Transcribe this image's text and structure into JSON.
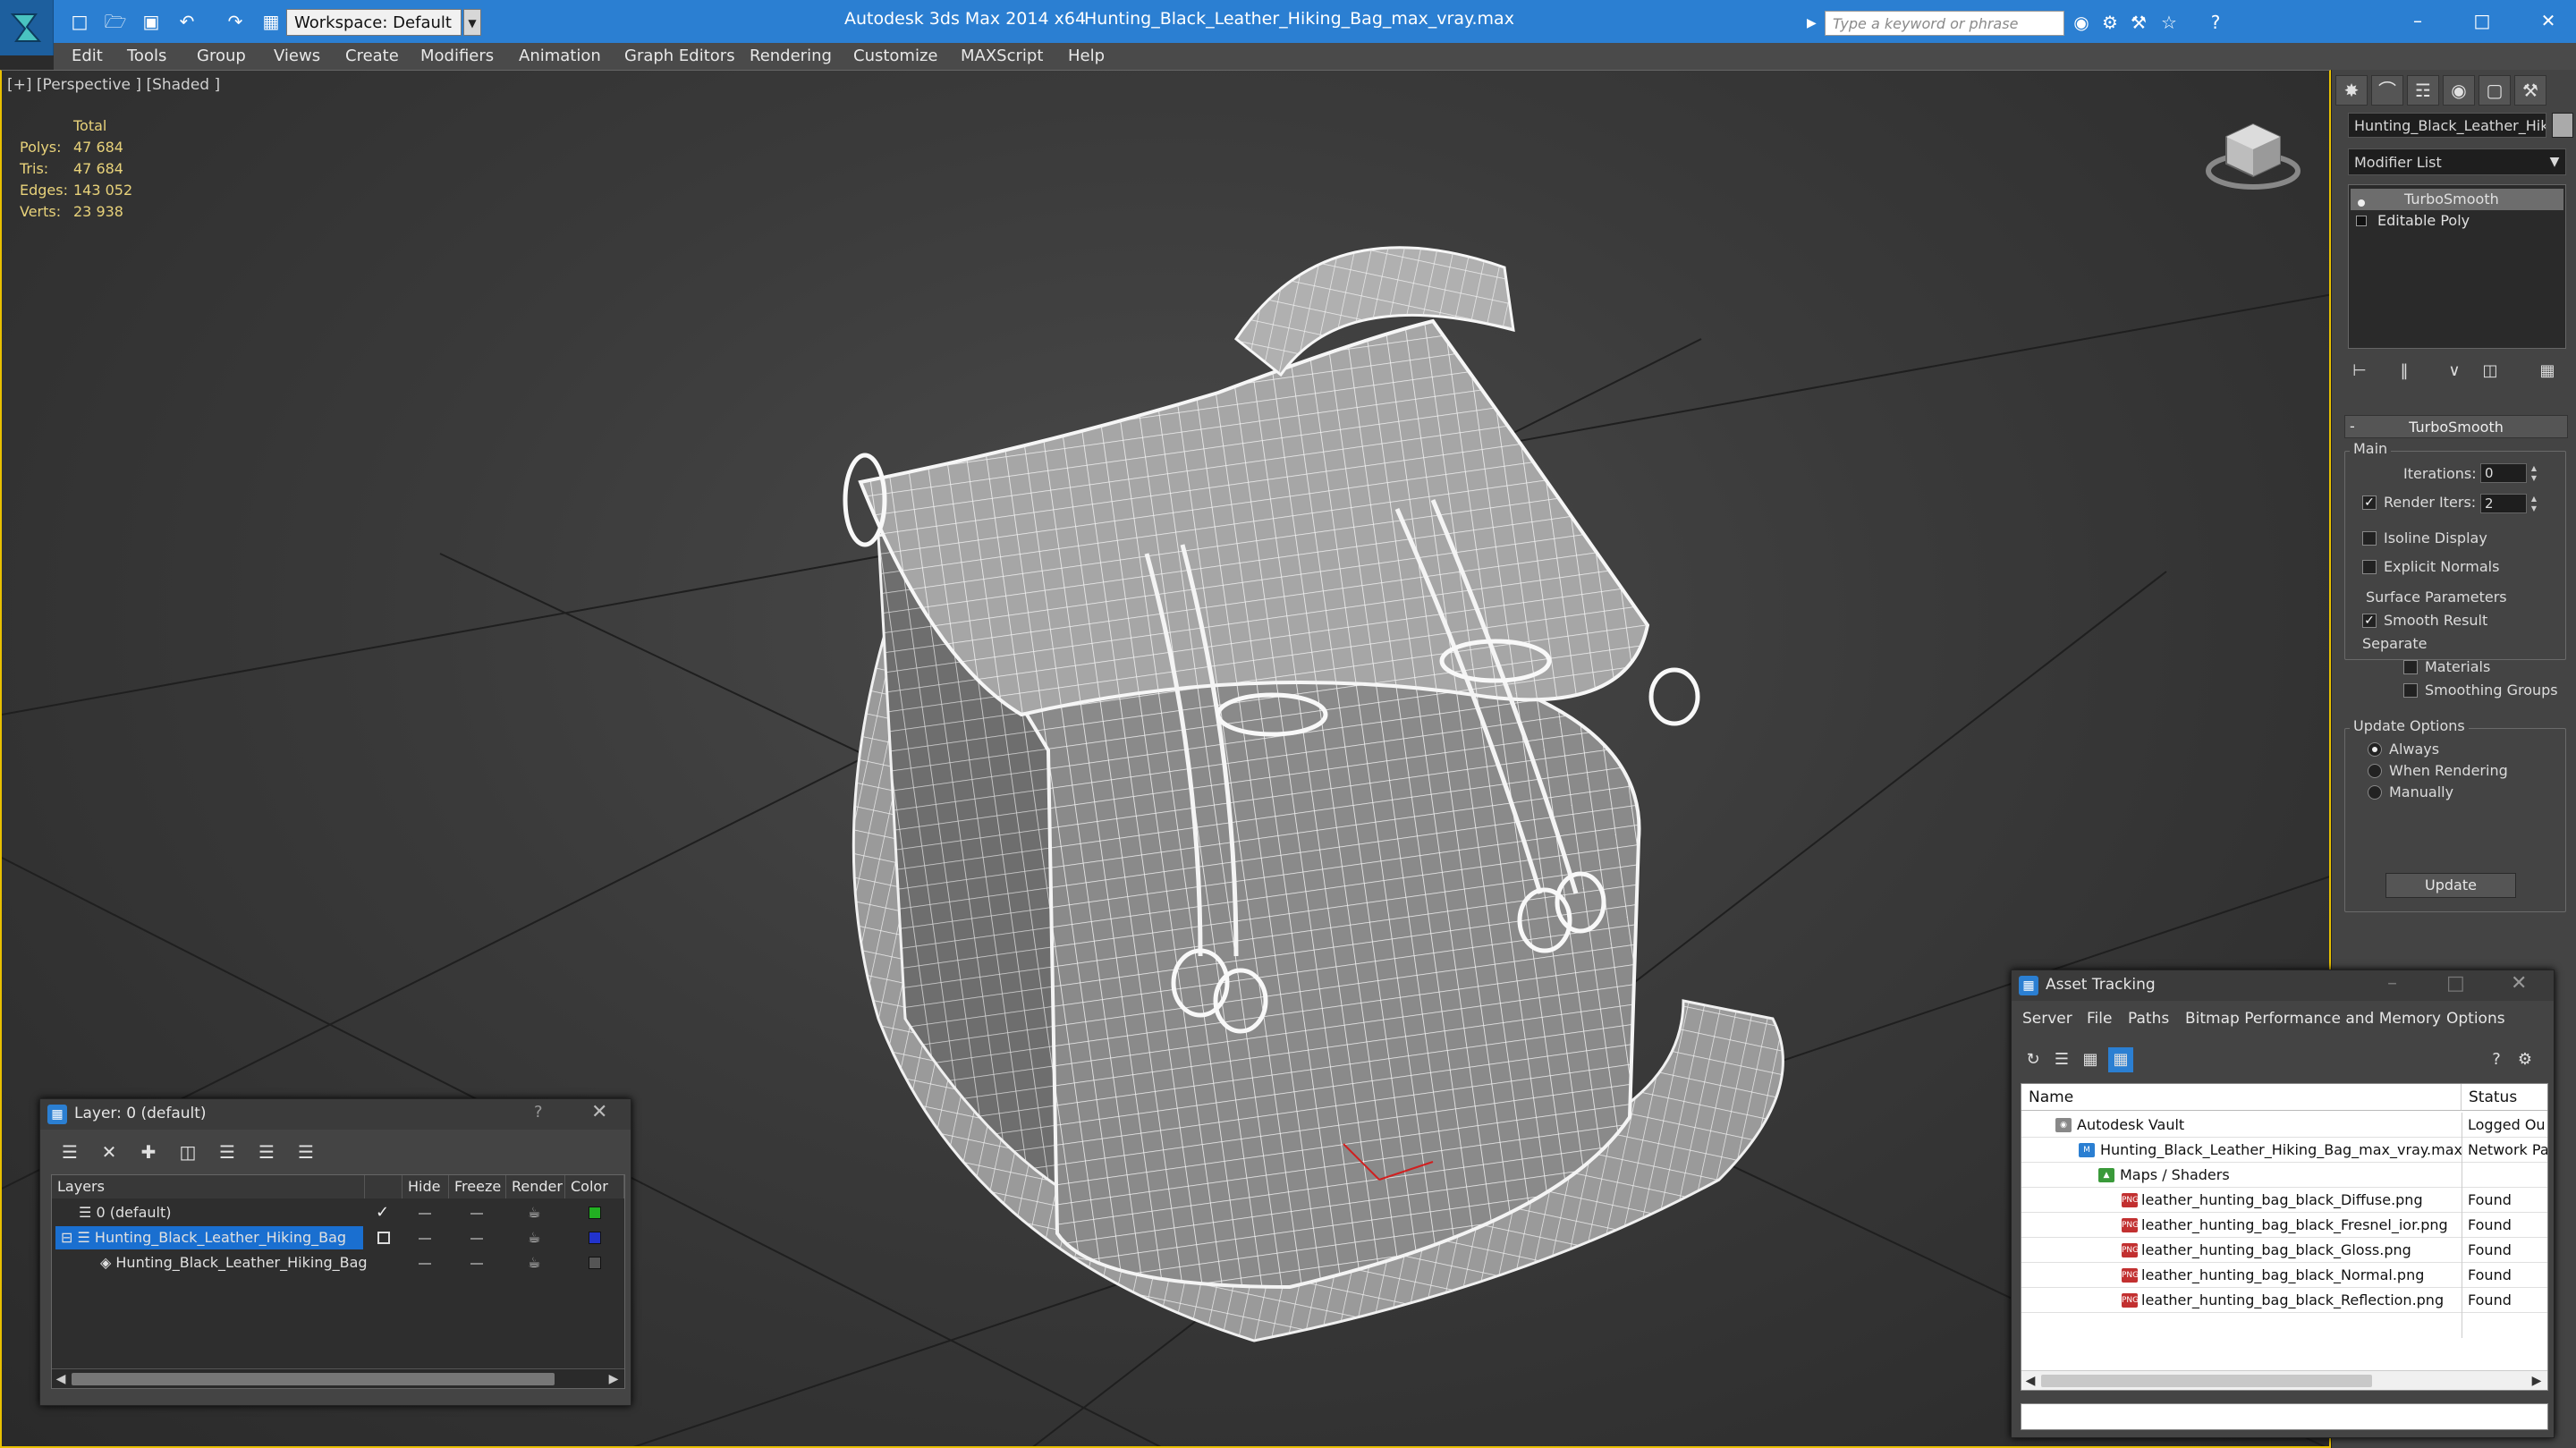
{
  "titlebar": {
    "workspace": "Workspace: Default",
    "app_title": "Autodesk 3ds Max  2014 x64",
    "doc_title": "Hunting_Black_Leather_Hiking_Bag_max_vray.max",
    "search_placeholder": "Type a keyword or phrase",
    "accent": "#2b7fd2"
  },
  "menu": [
    "Edit",
    "Tools",
    "Group",
    "Views",
    "Create",
    "Modifiers",
    "Animation",
    "Graph Editors",
    "Rendering",
    "Customize",
    "MAXScript",
    "Help"
  ],
  "viewport": {
    "label": "[+] [Perspective ] [Shaded ]",
    "stats": {
      "total_label": "Total",
      "rows": [
        {
          "label": "Polys:",
          "value": "47 684"
        },
        {
          "label": "Tris:",
          "value": "47 684"
        },
        {
          "label": "Edges:",
          "value": "143 052"
        },
        {
          "label": "Verts:",
          "value": "23 938"
        }
      ]
    }
  },
  "command_panel": {
    "object_name": "Hunting_Black_Leather_Hiking_Bag",
    "modifier_list": "Modifier List",
    "stack": [
      "TurboSmooth",
      "Editable Poly"
    ],
    "rollout_title": "TurboSmooth",
    "main_group": "Main",
    "iterations_label": "Iterations:",
    "iterations_value": "0",
    "render_iters_label": "Render Iters:",
    "render_iters_value": "2",
    "render_iters_checked": true,
    "isoline_display": "Isoline Display",
    "explicit_normals": "Explicit Normals",
    "surface_group": "Surface Parameters",
    "smooth_result": "Smooth Result",
    "separate_label": "Separate",
    "materials": "Materials",
    "smoothing_groups": "Smoothing Groups",
    "update_group": "Update Options",
    "always": "Always",
    "when_rendering": "When Rendering",
    "manually": "Manually",
    "update_button": "Update"
  },
  "layer_dialog": {
    "title": "Layer: 0 (default)",
    "help": "?",
    "columns": [
      "Layers",
      "Hide",
      "Freeze",
      "Render",
      "Color"
    ],
    "rows": [
      {
        "name": "0 (default)",
        "color": "#22b022"
      },
      {
        "name": "Hunting_Black_Leather_Hiking_Bag",
        "color": "#2233cc"
      },
      {
        "name": "Hunting_Black_Leather_Hiking_Bag",
        "color": "#555555"
      }
    ]
  },
  "asset_tracking": {
    "title": "Asset Tracking",
    "menu": [
      "Server",
      "File",
      "Paths",
      "Bitmap Performance and Memory",
      "Options"
    ],
    "columns": [
      "Name",
      "Status"
    ],
    "rows": [
      {
        "name": "Autodesk Vault",
        "status": "Logged Ou"
      },
      {
        "name": "Hunting_Black_Leather_Hiking_Bag_max_vray.max",
        "status": "Network Pa"
      },
      {
        "name": "Maps / Shaders",
        "status": ""
      },
      {
        "name": "leather_hunting_bag_black_Diffuse.png",
        "status": "Found"
      },
      {
        "name": "leather_hunting_bag_black_Fresnel_ior.png",
        "status": "Found"
      },
      {
        "name": "leather_hunting_bag_black_Gloss.png",
        "status": "Found"
      },
      {
        "name": "leather_hunting_bag_black_Normal.png",
        "status": "Found"
      },
      {
        "name": "leather_hunting_bag_black_Reflection.png",
        "status": "Found"
      }
    ]
  }
}
